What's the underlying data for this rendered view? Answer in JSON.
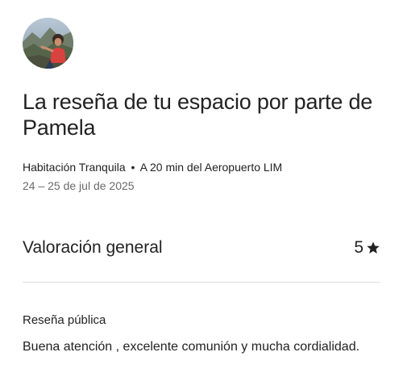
{
  "review": {
    "reviewer_name": "Pamela",
    "title": "La reseña de tu espacio por parte de Pamela",
    "listing_name": "Habitación Tranquila",
    "separator": "•",
    "listing_location": "A 20 min del Aeropuerto LIM",
    "dates": "24 – 25 de jul de 2025",
    "overall_label": "Valoración general",
    "overall_value": "5",
    "overall_icon": "star-icon",
    "public_review_label": "Reseña pública",
    "public_review_text": "Buena atención , excelente comunión y mucha cordialidad."
  },
  "colors": {
    "text_primary": "#222222",
    "text_secondary": "#6a6a6a",
    "divider": "#dddddd"
  }
}
